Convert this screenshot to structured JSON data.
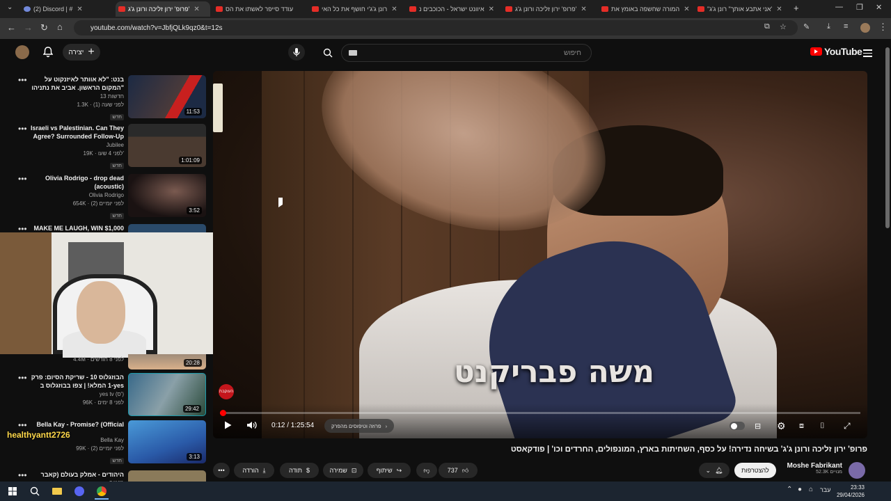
{
  "browser": {
    "url": "youtube.com/watch?v=JbfjQLk9qz0&t=12s",
    "tabs": [
      {
        "label": "(2) Discord | #",
        "active": false
      },
      {
        "label": "פרופ' ירון זליכה ורונן ג'ג'",
        "active": true
      },
      {
        "label": "עודד סייפר לאשתו את הס",
        "active": false
      },
      {
        "label": "רונן ג'ג'י חושף את כל האי",
        "active": false
      },
      {
        "label": "איוונט ישראל - הכוכבים נ",
        "active": false
      },
      {
        "label": "פרופ' ירון זליכה ורונן ג'ג'",
        "active": false
      },
      {
        "label": "המורה שחשפה באומץ את",
        "active": false
      },
      {
        "label": "\"אני אתבע אותך\" רונן ג'ג'",
        "active": false
      }
    ]
  },
  "youtube": {
    "logo": "YouTube",
    "search_placeholder": "חיפוש",
    "create_label": "יצירה"
  },
  "player": {
    "overlay_caption": "משה פבריקנט",
    "watermark": "העוקבת",
    "time": "0:12 / 1:25:54",
    "chapter": "פרוזה וטיפוסים מהפרק",
    "progress_fraction": 0.0023
  },
  "video": {
    "title": "פרופ' ירון זליכה ורונן ג'ג' בשיחה נדירה! על כסף, השחיתות בארץ, המונפולים, החרדים וכו' | פודקאסט",
    "channel": "Moshe Fabrikant",
    "subscribers": "52.3K מנויים",
    "subscribe_label": "להצטרפות",
    "likes": "737",
    "share_label": "שיתוף",
    "save_label": "שמירה",
    "thanks_label": "תודה",
    "download_label": "הורדה"
  },
  "recommendations": [
    {
      "title": "בנט: \"לא אוותר לאיזנקוט על המקום הראשון. אביב את נתניהו\"",
      "channel": "חדשות 13",
      "views": "1.3K · לפני שעה (1)",
      "badge": "חדש",
      "duration": "11:53"
    },
    {
      "title": "Israeli vs Palestinian. Can They Agree? Surrounded Follow-Up",
      "channel": "Jubilee",
      "views": "19K · לפני 4 שעו'",
      "badge": "חדש",
      "duration": "1:01:09"
    },
    {
      "title": "Olivia Rodrigo - drop dead (acoustic)",
      "channel": "Olivia Rodrigo",
      "views": "654K · לפני יומיים (2)",
      "badge": "חדש",
      "duration": "3:52"
    },
    {
      "title": "MAKE ME LAUGH, WIN $1,000",
      "channel": "",
      "views": "4.4M · לפני 8 חודשים",
      "badge": "",
      "duration": "20:28"
    },
    {
      "title": "הבוזגלוס 10 - שריקת הסיום: פרק 1 המלא! | צפו בבוזגלוס ב-yes",
      "channel": "yes tv (ס')",
      "views": "96K · לפני 8 ימים",
      "badge": "",
      "duration": "29:42"
    },
    {
      "title": "Bella Kay - Promise? (Official",
      "channel": "Bella Kay",
      "views": "99K · לפני יומיים (2)",
      "badge": "חדש",
      "duration": "3:13"
    },
    {
      "title": "היהודים - אמלק בעולם (קאבר מאיר",
      "channel": "",
      "views": "",
      "badge": "",
      "duration": ""
    }
  ],
  "stream_overlay": {
    "handle": "healthyantt2726"
  },
  "system": {
    "time": "23:33",
    "date": "29/04/2026",
    "lang": "עבר"
  }
}
